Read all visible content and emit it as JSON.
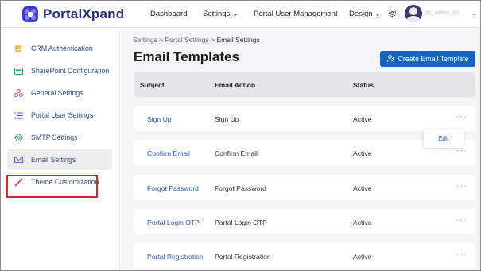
{
  "header": {
    "logo_text_a": "Portal",
    "logo_text_b": "Xpand",
    "nav": {
      "dashboard": "Dashboard",
      "settings": "Settings",
      "portal_user_management": "Portal User Management",
      "design": "Design"
    },
    "username": "rfc_admin_01"
  },
  "sidebar": {
    "items": [
      {
        "label": "CRM Authentication",
        "icon": "lock-icon"
      },
      {
        "label": "SharePoint Configuration",
        "icon": "sharepoint-icon"
      },
      {
        "label": "General Settings",
        "icon": "nodes-icon"
      },
      {
        "label": "Portal User Settings",
        "icon": "list-icon"
      },
      {
        "label": "SMTP Settings",
        "icon": "gear-icon"
      },
      {
        "label": "Email Settings",
        "icon": "envelope-icon"
      },
      {
        "label": "Theme Customization",
        "icon": "brush-icon"
      }
    ],
    "active_index": 5
  },
  "main": {
    "breadcrumb": {
      "root": "Settings",
      "mid": "Portal Settings",
      "current": "Email Settings",
      "sep": ">"
    },
    "title": "Email Templates",
    "create_button": "Create Email Template",
    "columns": {
      "subject": "Subject",
      "action": "Email Action",
      "status": "Status"
    },
    "rows": [
      {
        "subject": "Sign Up",
        "action": "Sign Up",
        "status": "Active"
      },
      {
        "subject": "Confirm Email",
        "action": "Confirm Email",
        "status": "Active"
      },
      {
        "subject": "Forgot Password",
        "action": "Forgot Password",
        "status": "Active"
      },
      {
        "subject": "Portal Login OTP",
        "action": "Portal Login OTP",
        "status": "Active"
      },
      {
        "subject": "Portal Registration",
        "action": "Portal Registration",
        "status": "Active"
      }
    ],
    "row_menu_label": "···",
    "popup_menu": {
      "edit": "Edit"
    }
  },
  "colors": {
    "brand": "#2b2b7c",
    "accent": "#1565c0",
    "link": "#2b59b6",
    "highlight": "#d9262c"
  }
}
